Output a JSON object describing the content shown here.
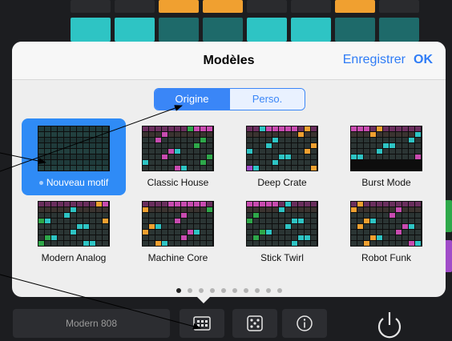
{
  "popover": {
    "title": "Modèles",
    "save_label": "Enregistrer",
    "ok_label": "OK",
    "segments": [
      {
        "label": "Origine",
        "active": true
      },
      {
        "label": "Perso.",
        "active": false
      }
    ],
    "templates": [
      {
        "label": "Nouveau motif",
        "selected": true
      },
      {
        "label": "Classic House",
        "selected": false
      },
      {
        "label": "Deep Crate",
        "selected": false
      },
      {
        "label": "Burst Mode",
        "selected": false
      },
      {
        "label": "Modern Analog",
        "selected": false
      },
      {
        "label": "Machine Core",
        "selected": false
      },
      {
        "label": "Stick Twirl",
        "selected": false
      },
      {
        "label": "Robot Funk",
        "selected": false
      }
    ],
    "page_count": 10,
    "active_page": 0
  },
  "bottom_bar": {
    "kit_name": "Modern 808",
    "buttons": [
      {
        "icon": "pattern-grid-icon"
      },
      {
        "icon": "dice-icon"
      },
      {
        "icon": "info-icon"
      }
    ],
    "power_icon": "power-icon"
  },
  "colors": {
    "accent": "#2f7cf6",
    "background": "#1c1d20",
    "popover": "#eeeeee",
    "teal_pad": "#2ec4c4",
    "orange_pad": "#f0a030",
    "purple_pad": "#a04cc8",
    "green_pad": "#2ea84a"
  }
}
